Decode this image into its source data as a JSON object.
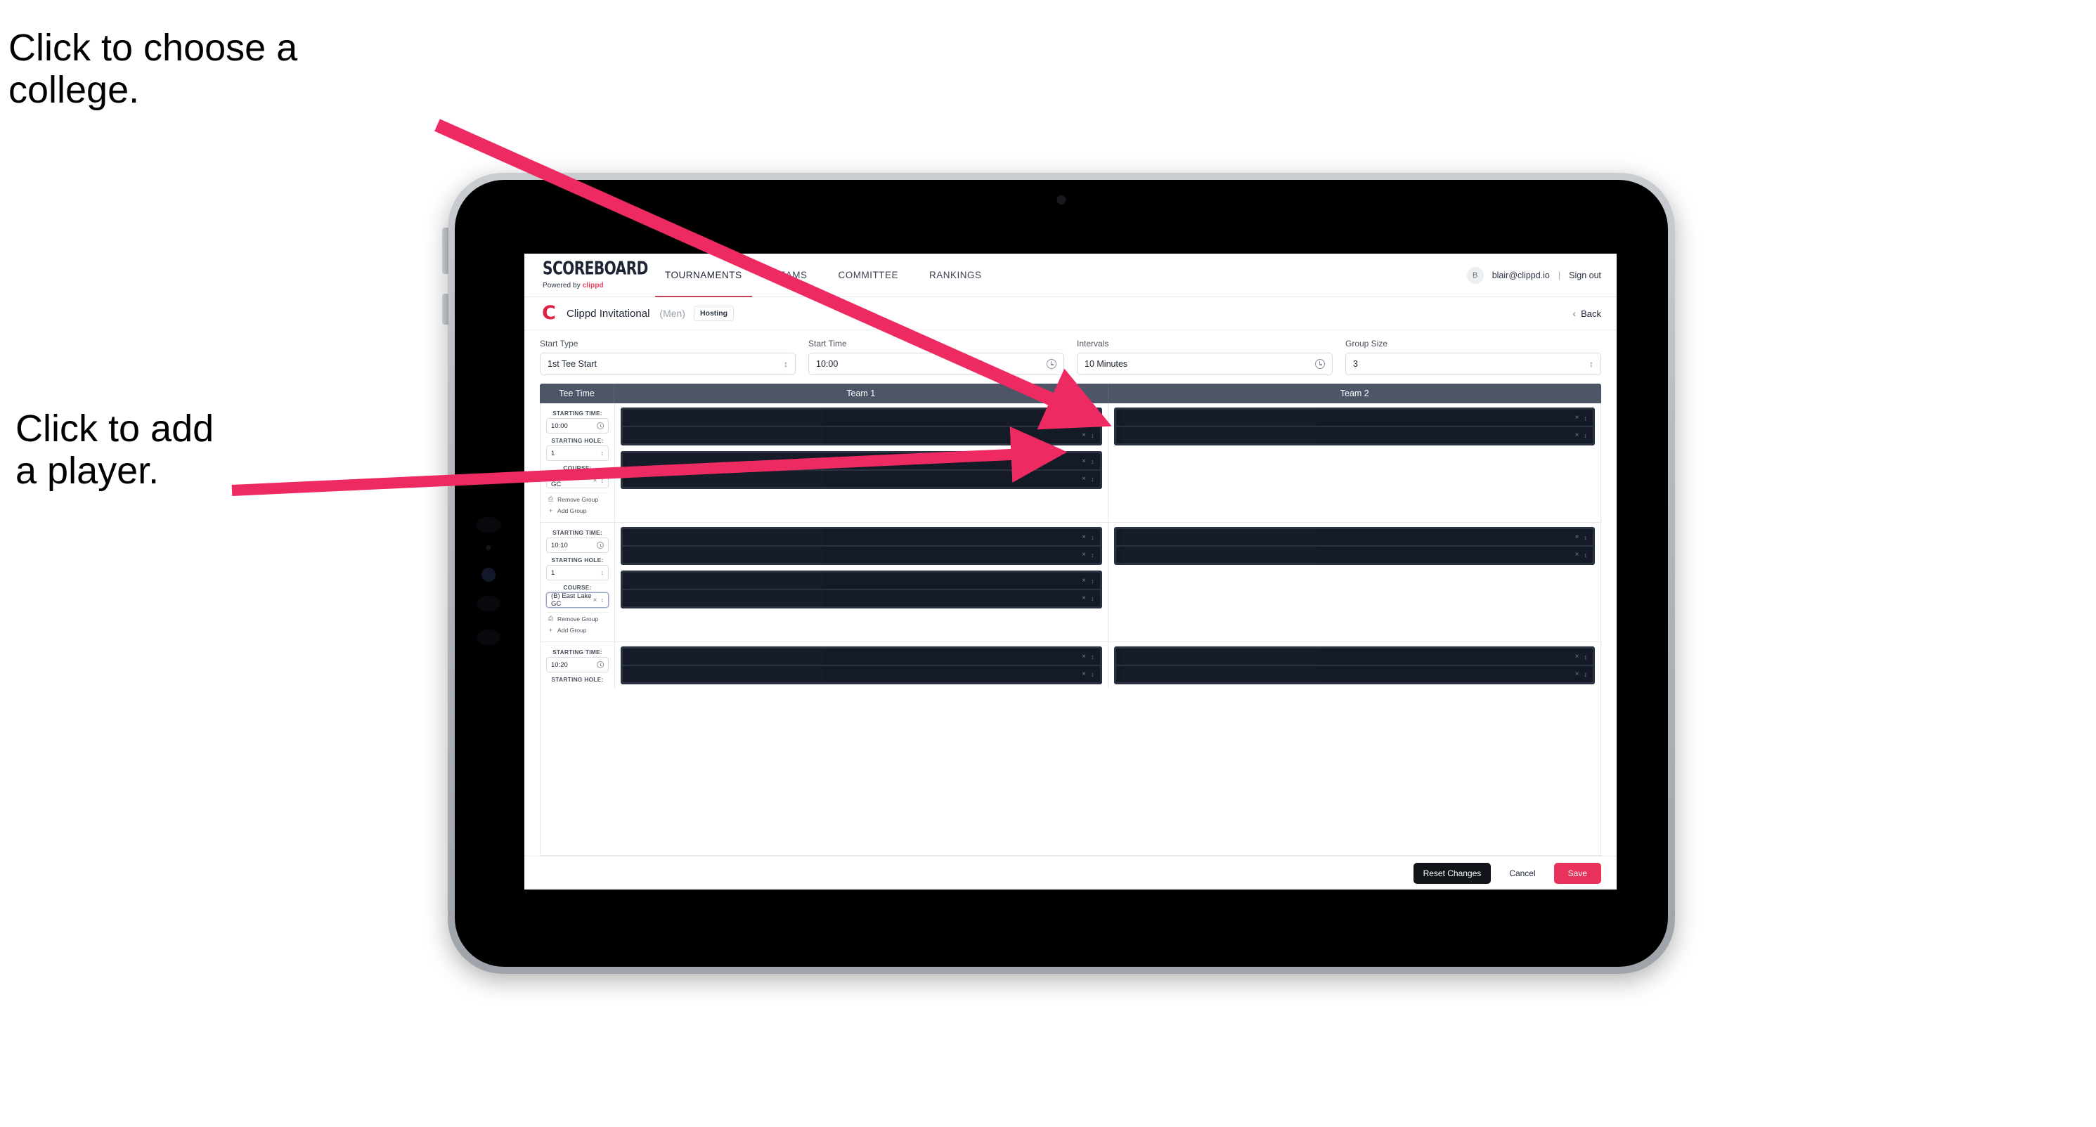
{
  "annotations": {
    "college": "Click to choose a\ncollege.",
    "player": "Click to add\na player."
  },
  "app": {
    "brand": {
      "name": "SCOREBOARD",
      "tagline_prefix": "Powered by ",
      "tagline_brand": "clippd"
    },
    "nav": [
      {
        "label": "TOURNAMENTS",
        "active": true
      },
      {
        "label": "TEAMS",
        "active": false
      },
      {
        "label": "COMMITTEE",
        "active": false
      },
      {
        "label": "RANKINGS",
        "active": false
      }
    ],
    "account": {
      "avatar_initial": "B",
      "email": "blair@clippd.io",
      "separator": "|",
      "sign_out": "Sign out"
    },
    "subheader": {
      "logo_letter": "C",
      "tournament": "Clippd Invitational",
      "gender": "(Men)",
      "badge": "Hosting",
      "back_chevron": "‹",
      "back_label": "Back"
    },
    "settings": [
      {
        "label": "Start Type",
        "value": "1st Tee Start",
        "icon": "updown-icon"
      },
      {
        "label": "Start Time",
        "value": "10:00",
        "icon": "clock-icon"
      },
      {
        "label": "Intervals",
        "value": "10 Minutes",
        "icon": "clock-icon"
      },
      {
        "label": "Group Size",
        "value": "3",
        "icon": "updown-icon"
      }
    ],
    "table": {
      "columns": [
        "Tee Time",
        "Team 1",
        "Team 2"
      ],
      "labels": {
        "time": "STARTING TIME:",
        "hole": "STARTING HOLE:",
        "course": "COURSE:"
      },
      "actions": {
        "remove": "Remove Group",
        "add": "Add Group",
        "remove_icon": "trash-icon",
        "add_icon": "plus-icon"
      },
      "slot_icons": {
        "clear": "×",
        "stepper": "⌃⌄"
      },
      "groups": [
        {
          "starting_time": "10:00",
          "starting_hole": "1",
          "course": "(A) Peachtree GC",
          "course_focused": false,
          "team1_blocks": [
            2,
            2
          ],
          "team2_blocks": [
            2
          ]
        },
        {
          "starting_time": "10:10",
          "starting_hole": "1",
          "course": "(B) East Lake GC",
          "course_focused": true,
          "team1_blocks": [
            2,
            2
          ],
          "team2_blocks": [
            2
          ]
        },
        {
          "starting_time": "10:20",
          "starting_hole": "",
          "course": "",
          "course_focused": false,
          "team1_blocks": [
            2
          ],
          "team2_blocks": [
            2
          ]
        }
      ]
    },
    "footer": {
      "reset": "Reset Changes",
      "cancel": "Cancel",
      "save": "Save"
    }
  },
  "colors": {
    "accent_pink": "#e8325c",
    "brand_red": "#e01f45",
    "table_header": "#4d5566",
    "slot_dark": "#141b27",
    "slot_group": "#2a3242",
    "annotation_arrow": "#ee2a62"
  }
}
